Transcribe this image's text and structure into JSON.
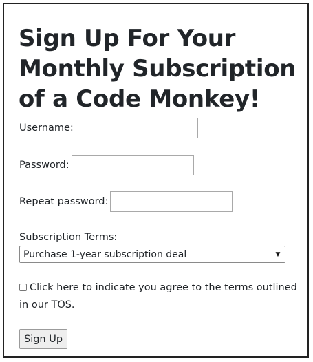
{
  "form": {
    "title": "Sign Up For Your Monthly Subscription of a Code Monkey!",
    "username": {
      "label": "Username:",
      "value": ""
    },
    "password": {
      "label": "Password:",
      "value": ""
    },
    "repeat_password": {
      "label": "Repeat password:",
      "value": ""
    },
    "subscription": {
      "label": "Subscription Terms:",
      "selected": "Purchase 1-year subscription deal"
    },
    "agree": {
      "checked": false,
      "label": "Click here to indicate you agree to the terms outlined in our TOS."
    },
    "submit_label": "Sign Up"
  },
  "icons": {
    "select_arrow": "chevron-down-icon"
  }
}
